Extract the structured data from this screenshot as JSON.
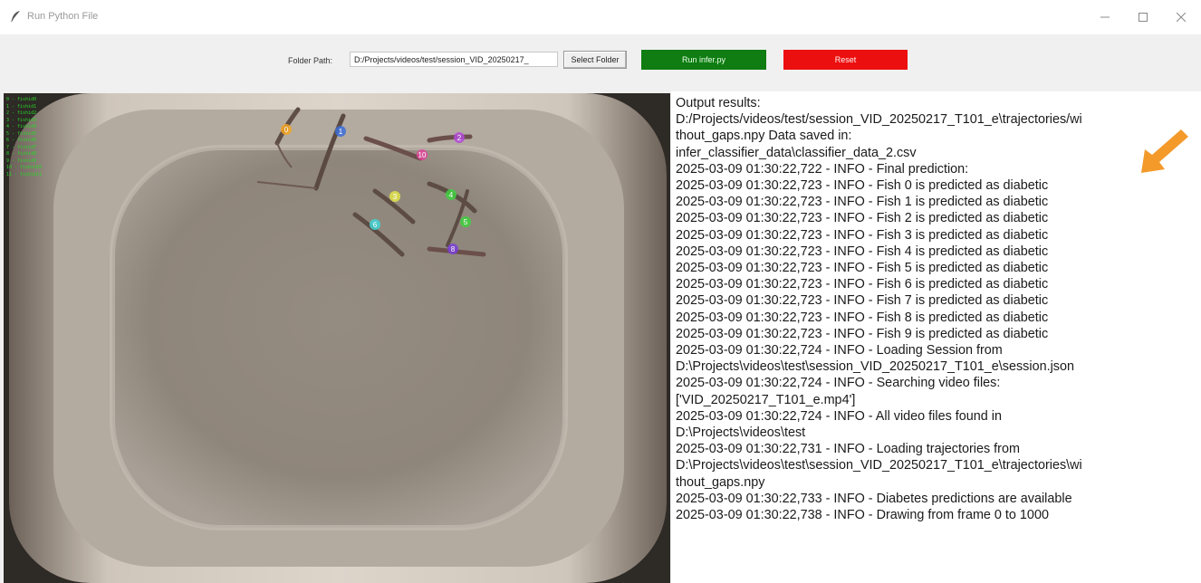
{
  "window": {
    "title": "Run Python File",
    "icon": "feather-icon",
    "controls": [
      "minimize-icon",
      "maximize-icon",
      "close-icon"
    ]
  },
  "toolbar": {
    "folder_label": "Folder Path:",
    "folder_value": "D:/Projects/videos/test/session_VID_20250217_",
    "select_folder_label": "Select Folder",
    "run_label": "Run infer.py",
    "reset_label": "Reset",
    "colors": {
      "run": "#0f7d12",
      "reset": "#ec0f0f"
    }
  },
  "video": {
    "legend": [
      "0 - fishid0",
      "1 - fishid1",
      "2 - fishid2",
      "3 - fishid3",
      "4 - fishid4",
      "5 - fishid5",
      "6 - fishid6",
      "7 - fishid7",
      "8 - fishid8",
      "9 - fishid9",
      "10 - fishid10",
      "11 - fishid11"
    ],
    "fish_labels": [
      {
        "id": "0",
        "color": "#f5a623"
      },
      {
        "id": "1",
        "color": "#3b6fd9"
      },
      {
        "id": "2",
        "color": "#b24ad8"
      },
      {
        "id": "3",
        "color": "#e3e34a"
      },
      {
        "id": "4",
        "color": "#3fd13f"
      },
      {
        "id": "5",
        "color": "#3fd13f"
      },
      {
        "id": "6",
        "color": "#3fd6d6"
      },
      {
        "id": "8",
        "color": "#7a3fd8"
      },
      {
        "id": "10",
        "color": "#e0459b"
      }
    ]
  },
  "output": {
    "lines": [
      "Output results:",
      "D:/Projects/videos/test/session_VID_20250217_T101_e\\trajectories/wi",
      "thout_gaps.npy Data saved in:",
      "infer_classifier_data\\classifier_data_2.csv",
      "2025-03-09 01:30:22,722 - INFO - Final prediction:",
      "2025-03-09 01:30:22,723 - INFO - Fish 0 is predicted as diabetic",
      "2025-03-09 01:30:22,723 - INFO - Fish 1 is predicted as diabetic",
      "2025-03-09 01:30:22,723 - INFO - Fish 2 is predicted as diabetic",
      "2025-03-09 01:30:22,723 - INFO - Fish 3 is predicted as diabetic",
      "2025-03-09 01:30:22,723 - INFO - Fish 4 is predicted as diabetic",
      "2025-03-09 01:30:22,723 - INFO - Fish 5 is predicted as diabetic",
      "2025-03-09 01:30:22,723 - INFO - Fish 6 is predicted as diabetic",
      "2025-03-09 01:30:22,723 - INFO - Fish 7 is predicted as diabetic",
      "2025-03-09 01:30:22,723 - INFO - Fish 8 is predicted as diabetic",
      "2025-03-09 01:30:22,723 - INFO - Fish 9 is predicted as diabetic",
      "2025-03-09 01:30:22,724 - INFO - Loading Session from",
      "D:\\Projects\\videos\\test\\session_VID_20250217_T101_e\\session.json",
      "2025-03-09 01:30:22,724 - INFO - Searching video files:",
      "['VID_20250217_T101_e.mp4']",
      "2025-03-09 01:30:22,724 - INFO - All video files found in",
      "D:\\Projects\\videos\\test",
      "2025-03-09 01:30:22,731 - INFO - Loading trajectories from",
      "D:\\Projects\\videos\\test\\session_VID_20250217_T101_e\\trajectories\\wi",
      "thout_gaps.npy",
      "2025-03-09 01:30:22,733 - INFO - Diabetes predictions are available",
      "2025-03-09 01:30:22,738 - INFO - Drawing from frame 0 to 1000"
    ],
    "annotation_icon": "arrow-down-left-icon",
    "annotation_color": "#f39a2b"
  }
}
